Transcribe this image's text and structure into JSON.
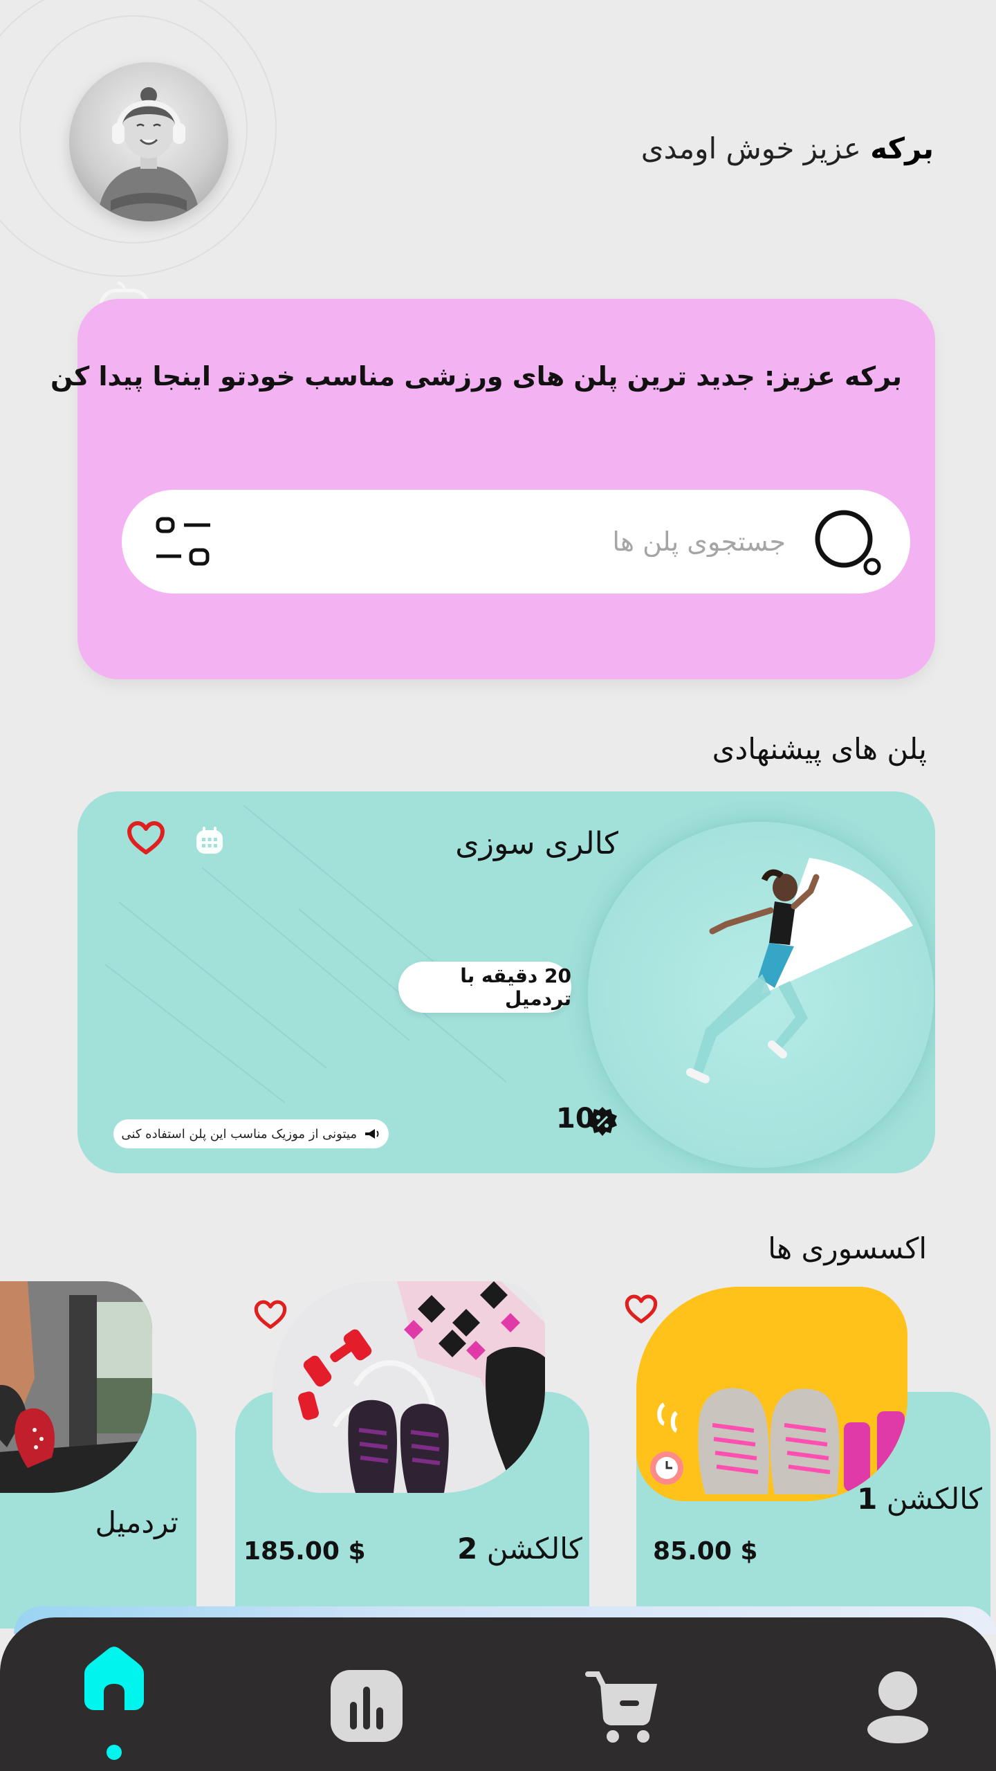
{
  "header": {
    "user_name": "برکه",
    "greeting_rest": " عزیز خوش اومدی"
  },
  "hero": {
    "title_name": "برکه عزیز: ",
    "title_rest": " جدید ترین پلن های ورزشی مناسب خودتو اینجا پیدا کن",
    "search_placeholder": "جستجوی پلن ها"
  },
  "sections": {
    "suggested_plans": "پلن های پیشنهادی",
    "accessories": "اکسسوری ها"
  },
  "plan_card": {
    "title": "کالری سوزی",
    "duration": "20 دقیقه با تردمیل",
    "discount_count": "10",
    "music_hint": "میتونی از موزیک مناسب این پلن استفاده کنی"
  },
  "accessories": [
    {
      "name": "کالکشن",
      "number": "1",
      "price": "85.00 $"
    },
    {
      "name": "کالکشن",
      "number": "2",
      "price": "185.00 $"
    },
    {
      "name": "تردمیل"
    }
  ],
  "colors": {
    "background": "#ebebeb",
    "hero_pink": "#f3b2f1",
    "card_teal": "#a2e0da",
    "nav_dark": "#2e2c2c",
    "nav_active": "#00f5ee",
    "nav_inactive": "#d9d9d9",
    "heart_red": "#e01f1f"
  },
  "nav": {
    "items": [
      "home-icon",
      "stats-icon",
      "cart-icon",
      "profile-icon"
    ],
    "active": "home-icon"
  }
}
